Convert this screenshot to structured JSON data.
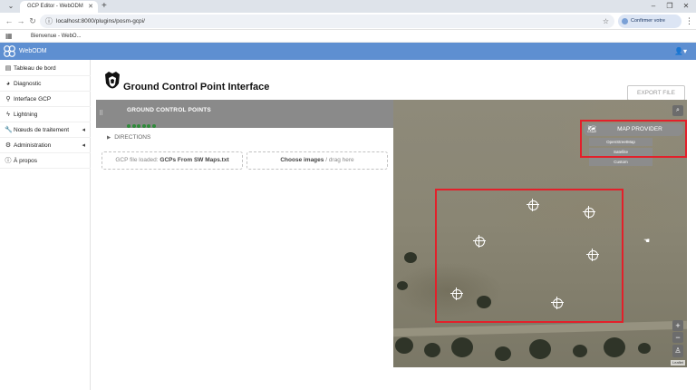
{
  "browser": {
    "tab_title": "GCP Editor - WebODM",
    "url": "localhost:8000/plugins/posm-gcpi/",
    "confirm_identity": "Confirmer votre identité",
    "bookmark": "Bienvenue - WebO..."
  },
  "app": {
    "brand": "WebODM"
  },
  "sidebar": {
    "items": [
      {
        "label": "Tableau de bord"
      },
      {
        "label": "Diagnostic"
      },
      {
        "label": "Interface GCP"
      },
      {
        "label": "Lightning"
      },
      {
        "label": "Nœuds de traitement"
      },
      {
        "label": "Administration"
      },
      {
        "label": "À propos"
      }
    ]
  },
  "page": {
    "title": "Ground Control Point Interface",
    "export_label": "EXPORT FILE"
  },
  "gcp_panel": {
    "title": "GROUND CONTROL POINTS",
    "directions_label": "DIRECTIONS",
    "gcp_file_prefix": "GCP file loaded:",
    "gcp_file_name": "GCPs From SW Maps.txt",
    "images_label": "Choose images",
    "images_suffix": "/ drag here"
  },
  "map": {
    "provider_title": "MAP PROVIDER",
    "provider_options": [
      "OpenStreetMap",
      "Satellite",
      "Custom"
    ],
    "zoom_in": "+",
    "zoom_out": "−",
    "attribution": "Leaflet"
  },
  "colors": {
    "navbar": "#5e8fd1",
    "highlight_box": "#e3202a",
    "gcp_status": "#2f8a3a"
  }
}
